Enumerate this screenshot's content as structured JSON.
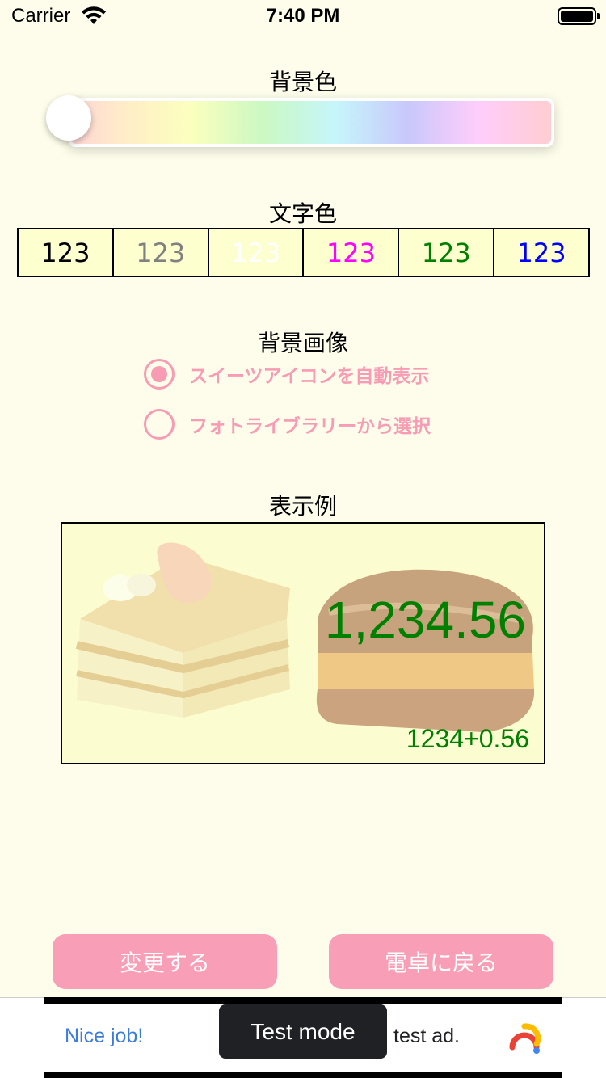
{
  "status_bar": {
    "carrier": "Carrier",
    "time": "7:40 PM"
  },
  "background_color": {
    "title": "背景色",
    "slider_value": 0
  },
  "text_color": {
    "title": "文字色",
    "options": [
      {
        "label": "123",
        "color": "#000000"
      },
      {
        "label": "123",
        "color": "#808080"
      },
      {
        "label": "123",
        "color": "#ffffff"
      },
      {
        "label": "123",
        "color": "#ff00ff"
      },
      {
        "label": "123",
        "color": "#008000"
      },
      {
        "label": "123",
        "color": "#0000ff"
      }
    ]
  },
  "background_image": {
    "title": "背景画像",
    "options": [
      {
        "label": "スイーツアイコンを自動表示",
        "checked": true
      },
      {
        "label": "フォトライブラリーから選択",
        "checked": false
      }
    ]
  },
  "preview": {
    "title": "表示例",
    "main_value": "1,234.56",
    "sub_value": "1234+0.56",
    "text_color": "#008000"
  },
  "buttons": {
    "change": "変更する",
    "back": "電卓に戻る"
  },
  "ad": {
    "title": "Nice job!",
    "text": "test ad.",
    "toast": "Test mode"
  },
  "colors": {
    "accent": "#f79cb4",
    "page_bg": "#fefdeb"
  }
}
